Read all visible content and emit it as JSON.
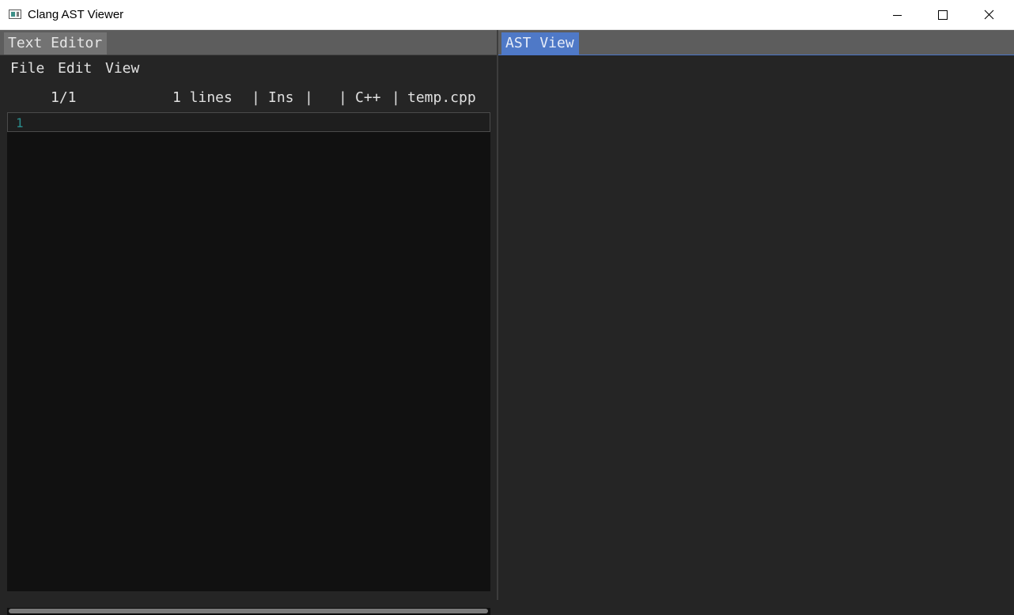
{
  "window": {
    "title": "Clang AST Viewer",
    "icon": "app-window-icon",
    "controls": {
      "minimize": "minimize-icon",
      "maximize": "maximize-icon",
      "close": "close-icon"
    }
  },
  "left_panel": {
    "tab_label": "Text Editor",
    "menu": {
      "file": "File",
      "edit": "Edit",
      "view": "View"
    },
    "status": {
      "position": "1/1",
      "lines": "1 lines",
      "sep1": "|",
      "mode": "Ins",
      "sep2": "|",
      "sep3": "|",
      "language": "C++",
      "sep4": "|",
      "filename": "temp.cpp"
    },
    "editor": {
      "line_numbers": [
        "1"
      ]
    }
  },
  "right_panel": {
    "tab_label": "AST View"
  },
  "colors": {
    "background": "#252525",
    "editor_background": "#111111",
    "tab_inactive": "#737373",
    "tab_active": "#4f79c7",
    "line_number": "#2a8c8c"
  }
}
